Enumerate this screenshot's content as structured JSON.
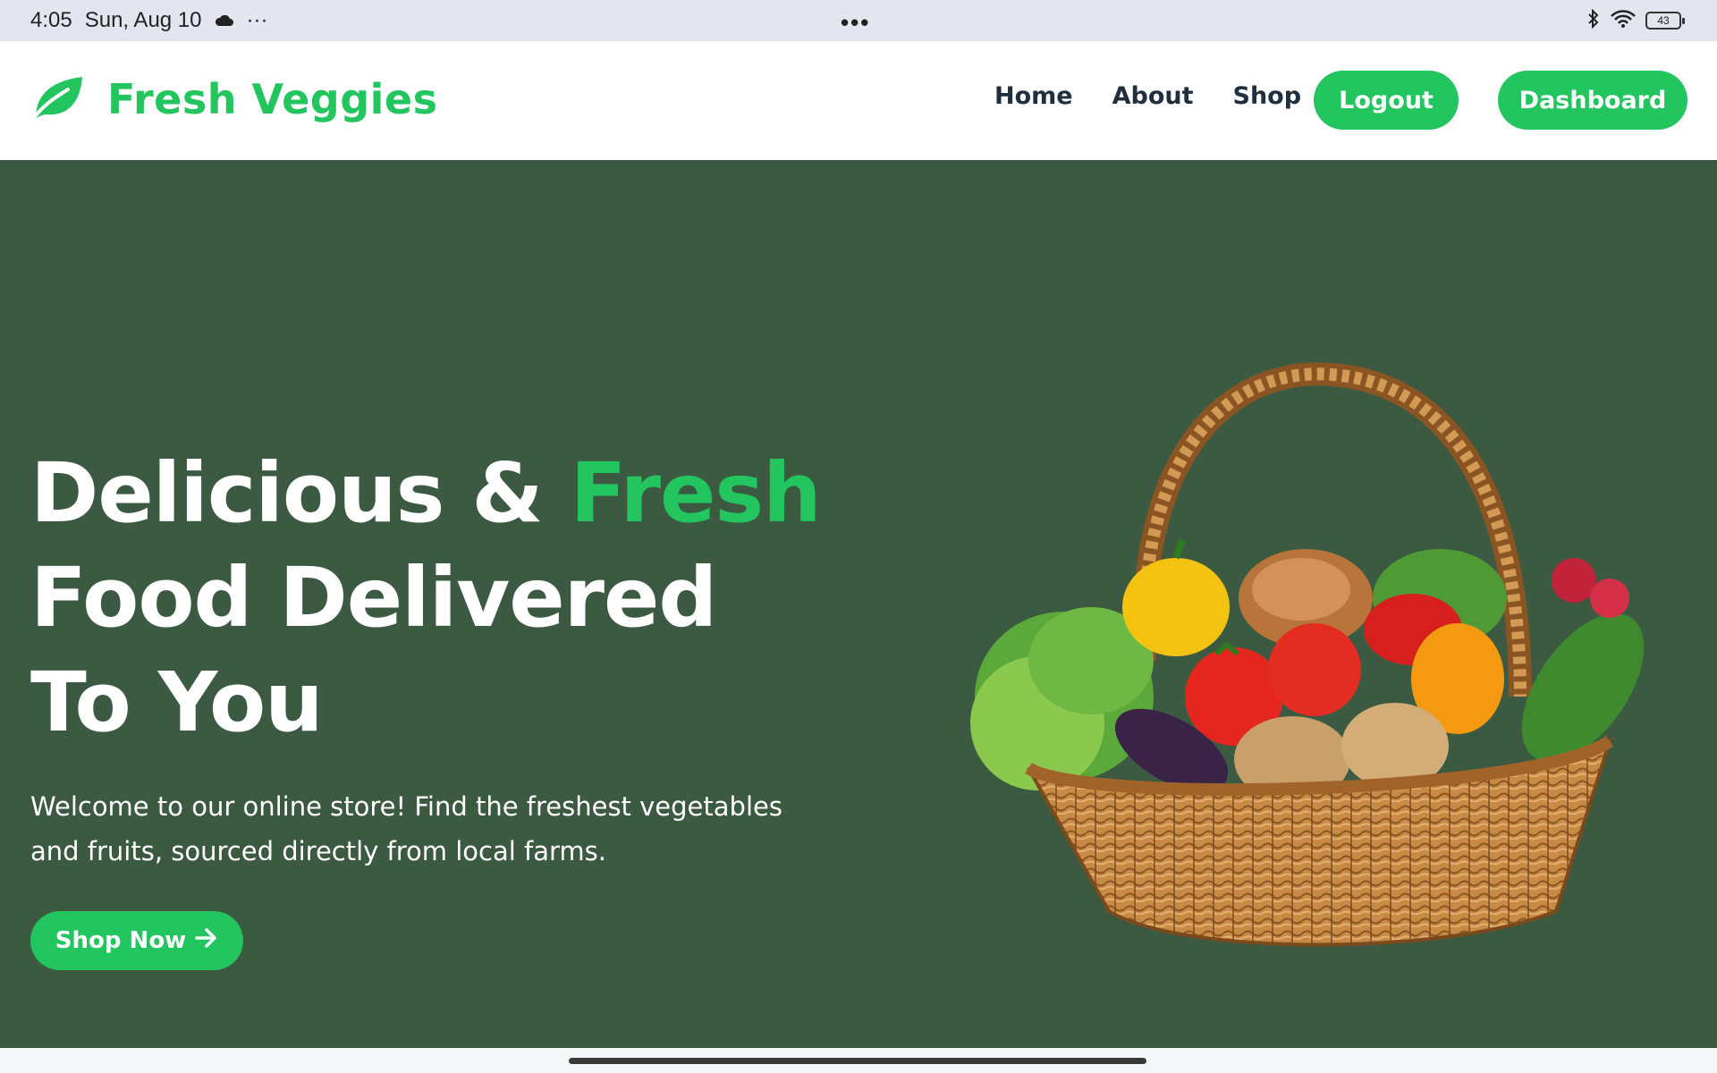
{
  "status_bar": {
    "time": "4:05",
    "date": "Sun, Aug 10",
    "overflow": "···",
    "center_menu": "•••",
    "battery": "43",
    "icons": [
      "cloud-icon",
      "bluetooth-icon",
      "wifi-icon",
      "battery-icon"
    ]
  },
  "navbar": {
    "brand": "Fresh Veggies",
    "brand_icon": "leaf-icon",
    "links": [
      "Home",
      "About",
      "Shop"
    ],
    "logout_label": "Logout",
    "dashboard_label": "Dashboard"
  },
  "hero": {
    "title_part1": "Delicious & ",
    "title_accent": "Fresh",
    "title_part2": "Food Delivered To You",
    "subtitle": "Welcome to our online store! Find the freshest vegetables and fruits, sourced directly from local farms.",
    "cta_label": "Shop Now",
    "cta_icon": "arrow-right-icon",
    "image": "vegetable-basket-image"
  },
  "colors": {
    "accent": "#22c55e",
    "hero_bg": "#3c5a42",
    "nav_text": "#1f2f3d",
    "status_bg": "#e3e6ee"
  }
}
